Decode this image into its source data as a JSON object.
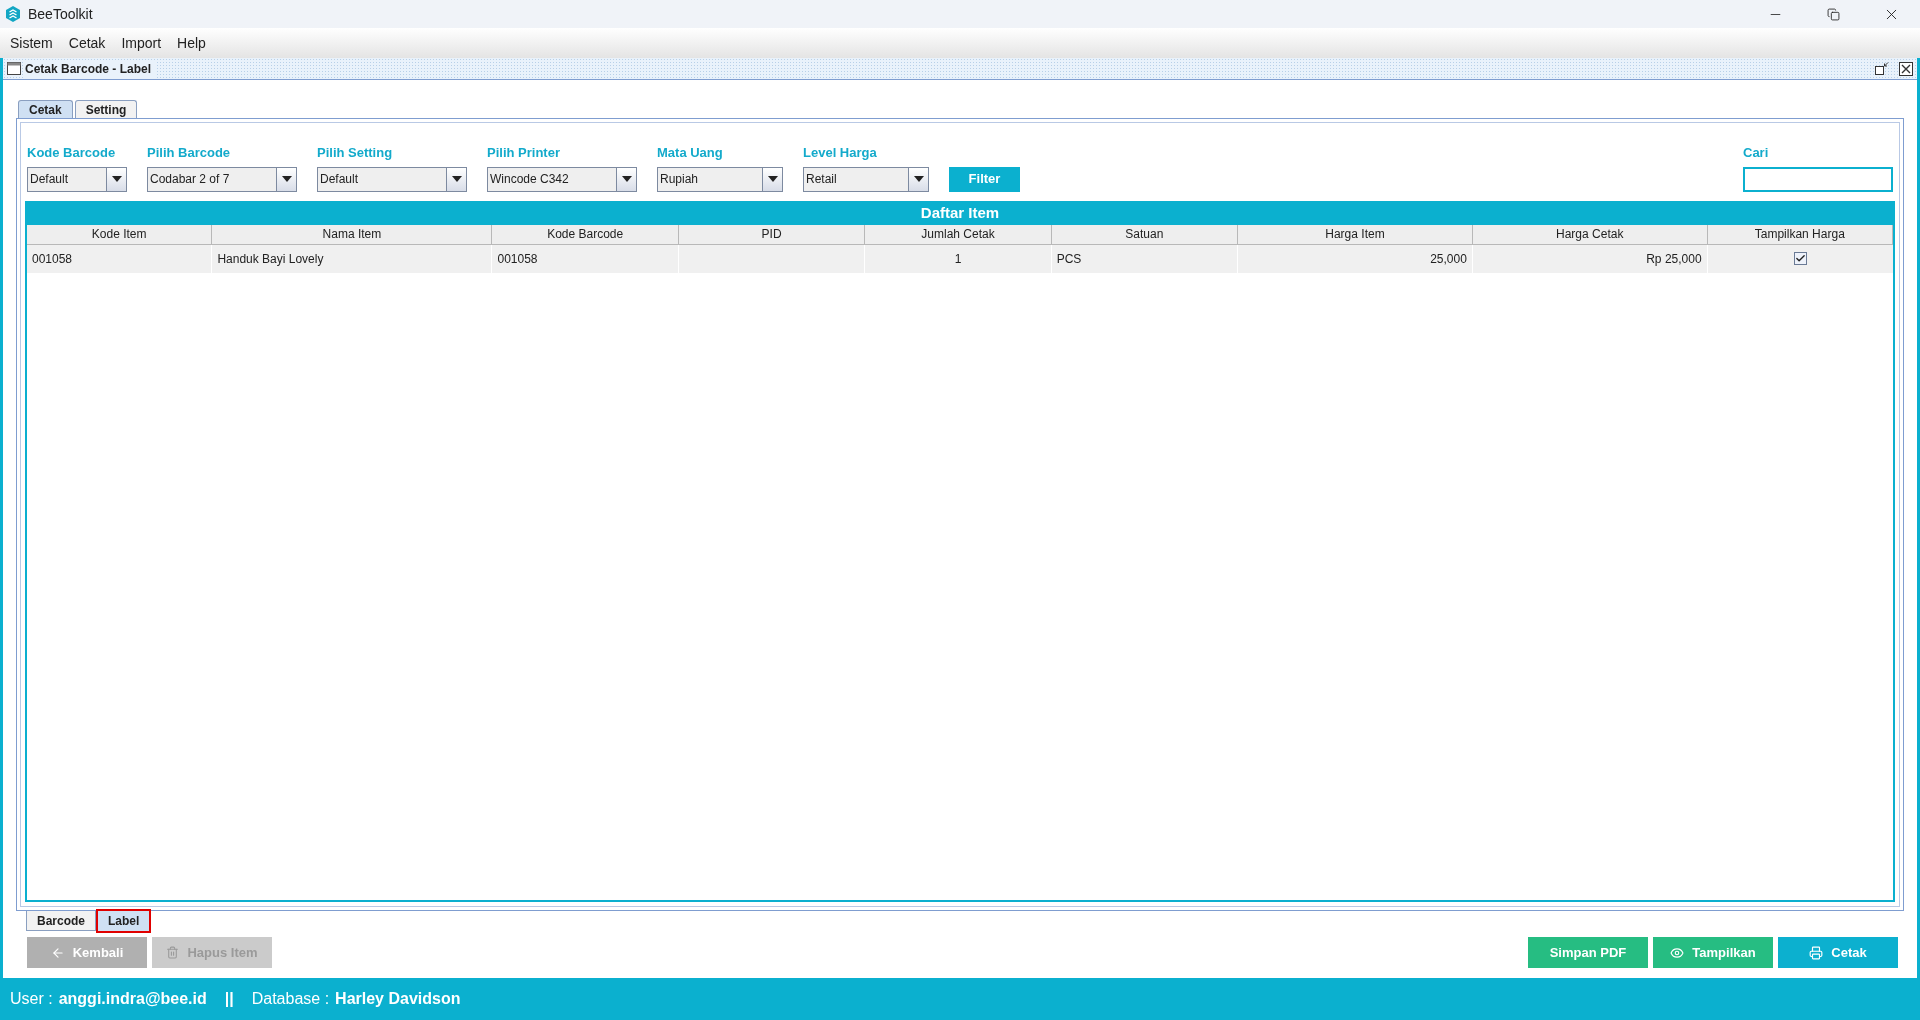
{
  "window": {
    "title": "BeeToolkit"
  },
  "menu": [
    "Sistem",
    "Cetak",
    "Import",
    "Help"
  ],
  "frame": {
    "title": "Cetak Barcode - Label"
  },
  "tabs": [
    {
      "label": "Cetak",
      "selected": true
    },
    {
      "label": "Setting",
      "selected": false
    }
  ],
  "filters": [
    {
      "label": "Kode Barcode",
      "value": "Default"
    },
    {
      "label": "Pilih Barcode",
      "value": "Codabar 2 of 7"
    },
    {
      "label": "Pilih Setting",
      "value": "Default"
    },
    {
      "label": "Pilih Printer",
      "value": "Wincode C342"
    },
    {
      "label": "Mata Uang",
      "value": "Rupiah"
    },
    {
      "label": "Level Harga",
      "value": "Retail"
    }
  ],
  "filter_button": "Filter",
  "search": {
    "label": "Cari"
  },
  "table": {
    "title": "Daftar Item",
    "columns": [
      "Kode Item",
      "Nama Item",
      "Kode Barcode",
      "PID",
      "Jumlah Cetak",
      "Satuan",
      "Harga Item",
      "Harga Cetak",
      "Tampilkan Harga"
    ],
    "rows": [
      {
        "cells": [
          "001058",
          "Handuk Bayi Lovely",
          "001058",
          "",
          "1",
          "PCS",
          "25,000",
          "Rp 25,000"
        ],
        "show_price": true
      }
    ]
  },
  "bottom_tabs": [
    {
      "label": "Barcode",
      "selected": false,
      "highlighted": false
    },
    {
      "label": "Label",
      "selected": true,
      "highlighted": true
    }
  ],
  "buttons_left": [
    {
      "label": "Kembali",
      "kind": "back",
      "disabled": false,
      "color": "#b0b0b0"
    },
    {
      "label": "Hapus Item",
      "kind": "delete",
      "disabled": true,
      "color": "#cbcbcb"
    }
  ],
  "buttons_right": [
    {
      "label": "Simpan PDF",
      "kind": "plain",
      "disabled": false,
      "color": "#26bd82"
    },
    {
      "label": "Tampilkan",
      "kind": "view",
      "disabled": false,
      "color": "#26bd82"
    },
    {
      "label": "Cetak",
      "kind": "print",
      "disabled": false,
      "color": "#0cb0cf"
    }
  ],
  "status": {
    "user_label": "User :",
    "user": "anggi.indra@bee.id",
    "separator": "||",
    "db_label": "Database :",
    "db": "Harley Davidson"
  }
}
